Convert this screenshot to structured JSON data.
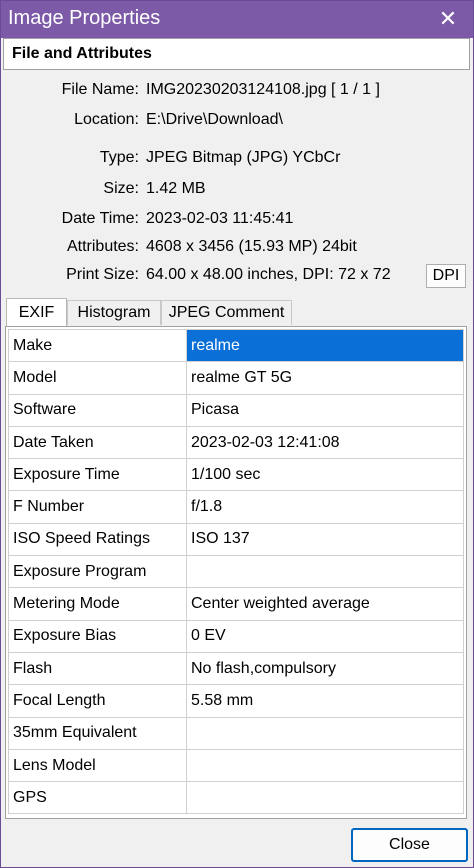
{
  "window": {
    "title": "Image Properties"
  },
  "group": {
    "title": "File and Attributes"
  },
  "info": [
    {
      "label": "File Name:",
      "value": "IMG20230203124108.jpg    [ 1 / 1 ]"
    },
    {
      "label": "Location:",
      "value": "E:\\Drive\\Download\\"
    },
    {
      "label": "Type:",
      "value": "JPEG Bitmap (JPG) YCbCr"
    },
    {
      "label": "Size:",
      "value": "1.42 MB"
    },
    {
      "label": "Date Time:",
      "value": "2023-02-03 11:45:41"
    },
    {
      "label": "Attributes:",
      "value": "4608 x 3456 (15.93 MP)  24bit"
    },
    {
      "label": "Print Size:",
      "value": "64.00 x 48.00 inches,  DPI: 72 x 72"
    }
  ],
  "dpi_button": "DPI",
  "tabs": [
    "EXIF",
    "Histogram",
    "JPEG Comment"
  ],
  "exif": [
    {
      "key": "Make",
      "value": "realme"
    },
    {
      "key": "Model",
      "value": "realme GT 5G"
    },
    {
      "key": "Software",
      "value": "Picasa"
    },
    {
      "key": "Date Taken",
      "value": "2023-02-03 12:41:08"
    },
    {
      "key": "Exposure Time",
      "value": "1/100 sec"
    },
    {
      "key": "F Number",
      "value": "f/1.8"
    },
    {
      "key": "ISO Speed Ratings",
      "value": "ISO 137"
    },
    {
      "key": "Exposure Program",
      "value": ""
    },
    {
      "key": "Metering Mode",
      "value": "Center weighted average"
    },
    {
      "key": "Exposure Bias",
      "value": "0 EV"
    },
    {
      "key": "Flash",
      "value": "No flash,compulsory"
    },
    {
      "key": "Focal Length",
      "value": "5.58 mm"
    },
    {
      "key": "35mm Equivalent",
      "value": ""
    },
    {
      "key": "Lens Model",
      "value": ""
    },
    {
      "key": "GPS",
      "value": ""
    }
  ],
  "close_button": "Close",
  "colors": {
    "titlebar": "#7c5aa8",
    "selection": "#0a6fd6",
    "focus": "#0067c0"
  }
}
